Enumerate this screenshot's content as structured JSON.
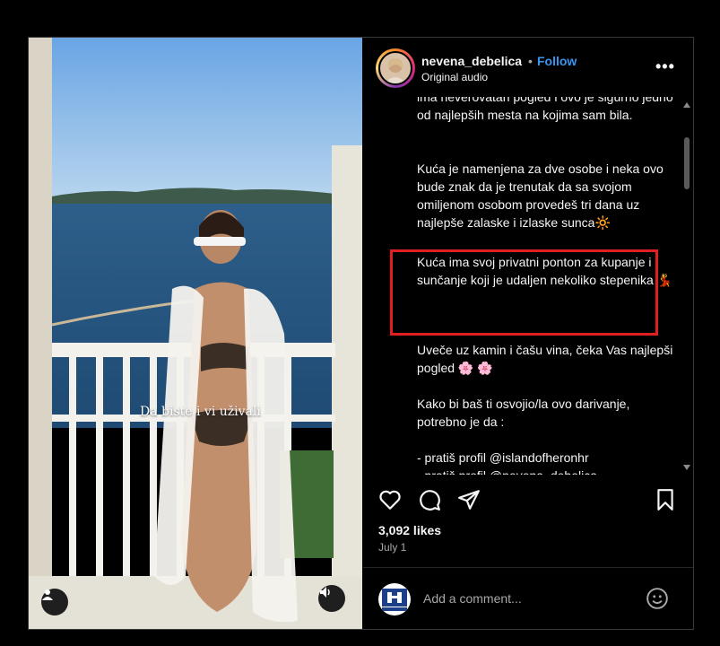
{
  "post": {
    "username": "nevena_debelica",
    "separator": "•",
    "follow_label": "Follow",
    "audio_label": "Original audio",
    "more_label": "•••"
  },
  "media": {
    "overlay_text": "Da biste i vi uživali"
  },
  "caption": {
    "lines": [
      "ima neverovatan pogled i ovo je sigurno jedno od najlepših mesta na kojima sam bila.",
      "Kuća je namenjena za dve osobe i neka ovo bude znak da je trenutak da sa svojom omiljenom osobom provedeš tri dana uz najlepše zalaske i izlaske sunca🔆",
      "Kuća ima svoj privatni ponton za kupanje i sunčanje koji je udaljen nekoliko stepenika 💃",
      "Uveče uz kamin i čašu vina, čeka Vas najlepši pogled 🌸 🌸",
      "Kako bi baš ti osvojio/la ovo darivanje, potrebno je da :",
      "- pratiš profil @islandofheronhr",
      "- pratiš profil @nevena_debelica"
    ]
  },
  "engagement": {
    "likes": "3,092 likes",
    "date": "July 1"
  },
  "comment_box": {
    "placeholder": "Add a comment..."
  },
  "icons": {
    "like": "heart-icon",
    "comment": "comment-icon",
    "share": "share-icon",
    "save": "bookmark-icon",
    "emoji": "emoji-icon",
    "sound": "speaker-icon",
    "tagged": "user-icon"
  },
  "colors": {
    "follow": "#3897f0",
    "highlight": "#e02020",
    "background": "#000000"
  }
}
